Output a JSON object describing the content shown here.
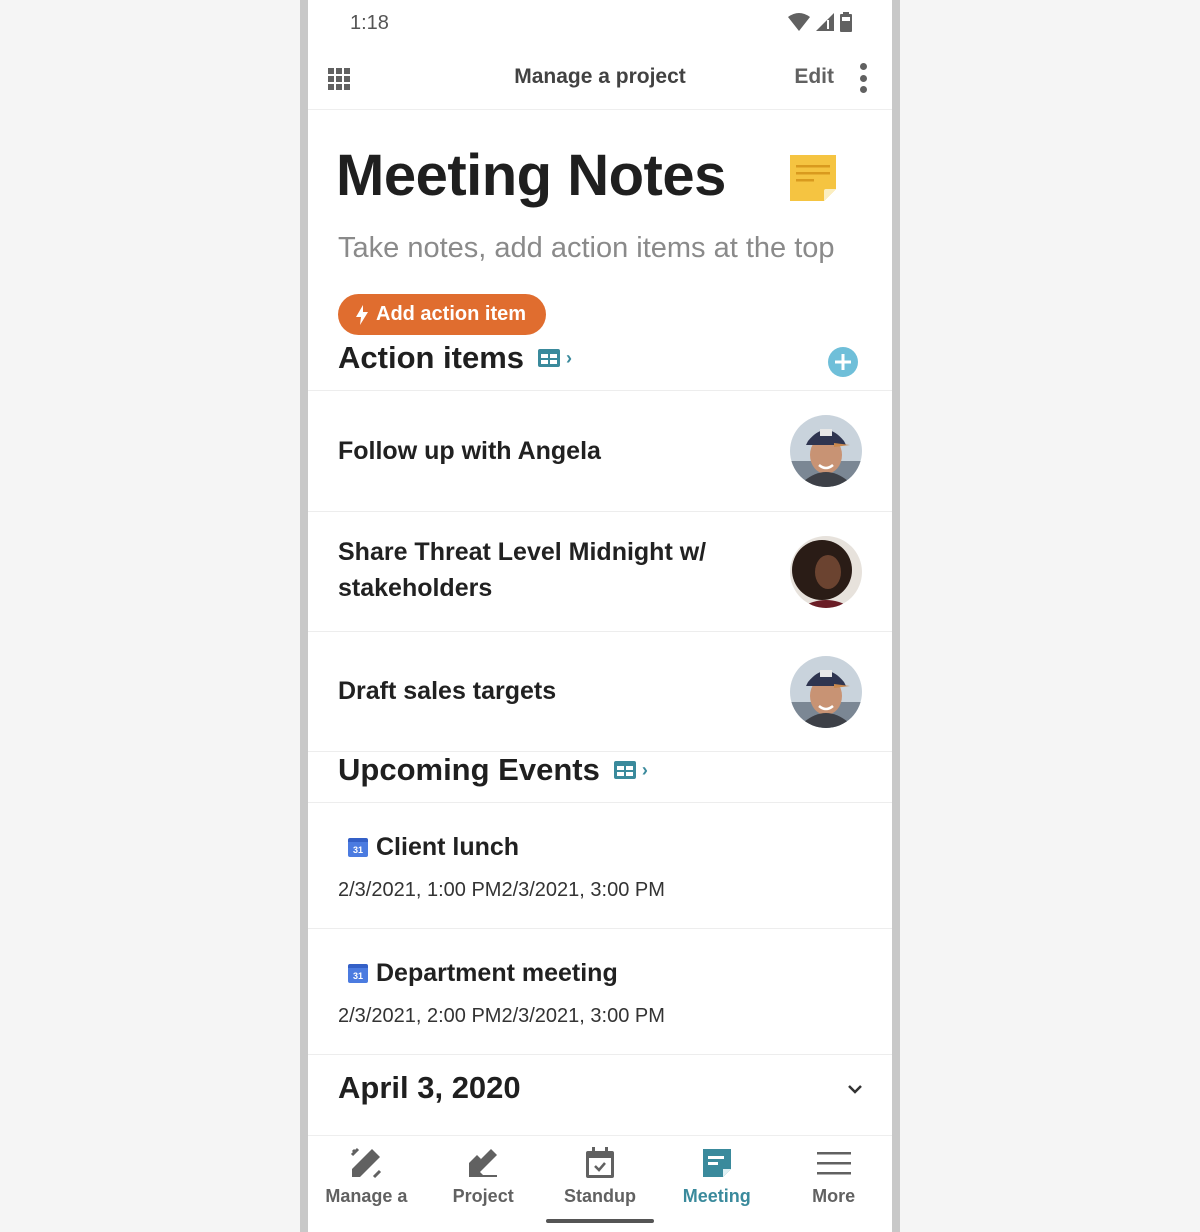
{
  "status_bar": {
    "time": "1:18",
    "icons": [
      "wifi-icon",
      "signal-icon",
      "battery-icon"
    ]
  },
  "app_bar": {
    "menu_icon": "grid-icon",
    "title": "Manage a project",
    "edit_label": "Edit",
    "more_icon": "kebab-icon"
  },
  "header": {
    "title": "Meeting Notes",
    "icon": "sticky-note-icon",
    "subtitle": "Take notes, add action items at the top",
    "add_action_label": "Add action item"
  },
  "action_items": {
    "title": "Action items",
    "items": [
      {
        "text": "Follow up with Angela",
        "assignee_avatar": "man-cap-avatar"
      },
      {
        "text": "Share Threat Level Midnight w/ stakeholders",
        "assignee_avatar": "woman-curly-hair-avatar"
      },
      {
        "text": "Draft sales targets",
        "assignee_avatar": "man-cap-avatar"
      }
    ]
  },
  "upcoming_events": {
    "title": "Upcoming Events",
    "items": [
      {
        "calendar_day": "31",
        "title": "Client lunch",
        "time": "2/3/2021, 1:00 PM2/3/2021, 3:00 PM"
      },
      {
        "calendar_day": "31",
        "title": "Department meeting",
        "time": "2/3/2021, 2:00 PM2/3/2021, 3:00 PM"
      }
    ]
  },
  "date_section": {
    "title": "April 3, 2020"
  },
  "bottom_nav": {
    "items": [
      {
        "label": "Manage a",
        "icon": "pencil-ruler-icon",
        "active": false
      },
      {
        "label": "Project",
        "icon": "project-pencil-icon",
        "active": false
      },
      {
        "label": "Standup",
        "icon": "calendar-check-icon",
        "active": false
      },
      {
        "label": "Meeting",
        "icon": "note-icon",
        "active": true
      },
      {
        "label": "More",
        "icon": "hamburger-icon",
        "active": false
      }
    ]
  },
  "colors": {
    "accent_orange": "#e06d2f",
    "accent_teal": "#3a8a9c",
    "add_circle": "#6fbfd9",
    "sticky_note": "#f5c441"
  }
}
